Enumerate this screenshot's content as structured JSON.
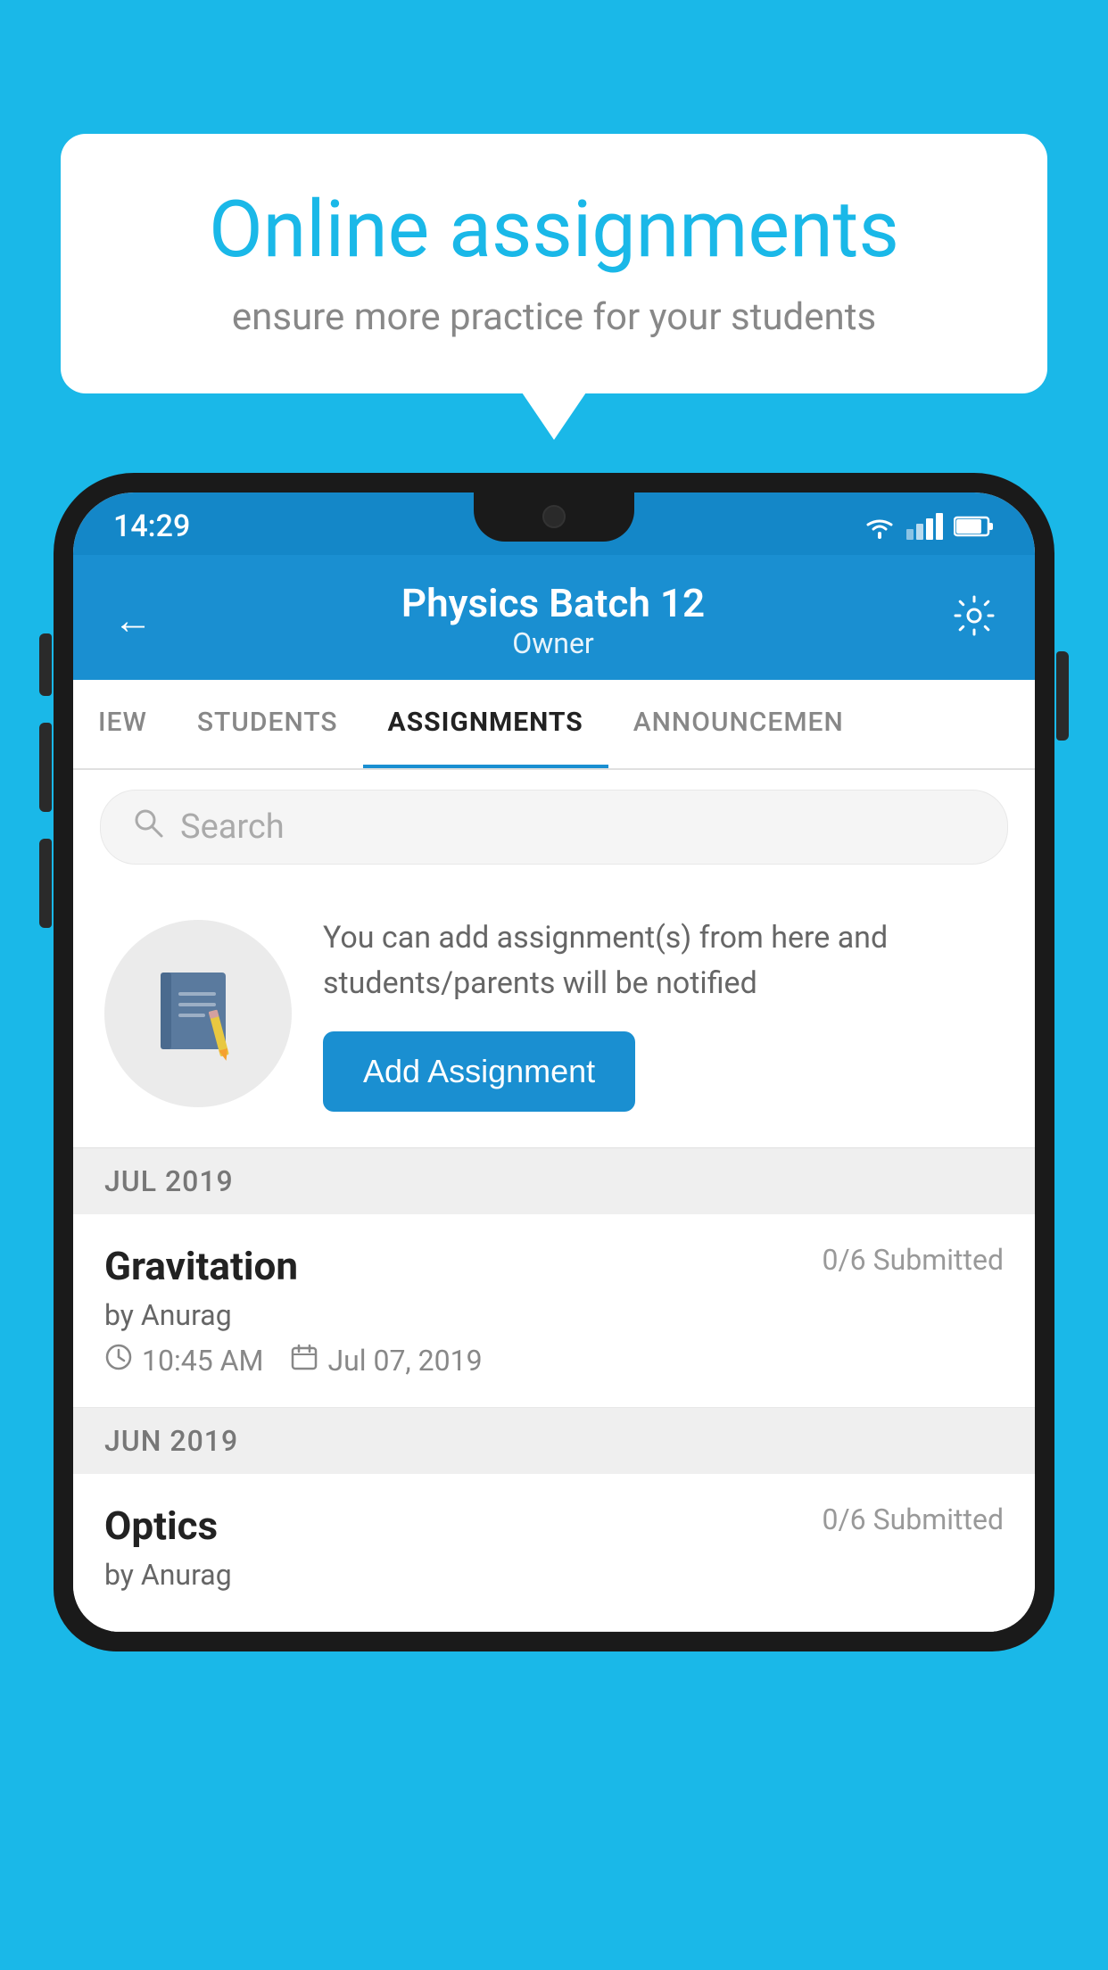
{
  "background_color": "#1ab8e8",
  "speech_bubble": {
    "title": "Online assignments",
    "subtitle": "ensure more practice for your students"
  },
  "status_bar": {
    "time": "14:29",
    "wifi": "▲",
    "battery": "🔋"
  },
  "header": {
    "title": "Physics Batch 12",
    "subtitle": "Owner",
    "back_label": "←",
    "settings_label": "⚙"
  },
  "tabs": [
    {
      "label": "IEW",
      "active": false
    },
    {
      "label": "STUDENTS",
      "active": false
    },
    {
      "label": "ASSIGNMENTS",
      "active": true
    },
    {
      "label": "ANNOUNCEMEN",
      "active": false
    }
  ],
  "search": {
    "placeholder": "Search"
  },
  "promo": {
    "text": "You can add assignment(s) from here and students/parents will be notified",
    "button_label": "Add Assignment"
  },
  "sections": [
    {
      "label": "JUL 2019",
      "assignments": [
        {
          "title": "Gravitation",
          "submitted": "0/6 Submitted",
          "author": "by Anurag",
          "time": "10:45 AM",
          "date": "Jul 07, 2019"
        }
      ]
    },
    {
      "label": "JUN 2019",
      "assignments": [
        {
          "title": "Optics",
          "submitted": "0/6 Submitted",
          "author": "by Anurag",
          "time": "",
          "date": ""
        }
      ]
    }
  ]
}
